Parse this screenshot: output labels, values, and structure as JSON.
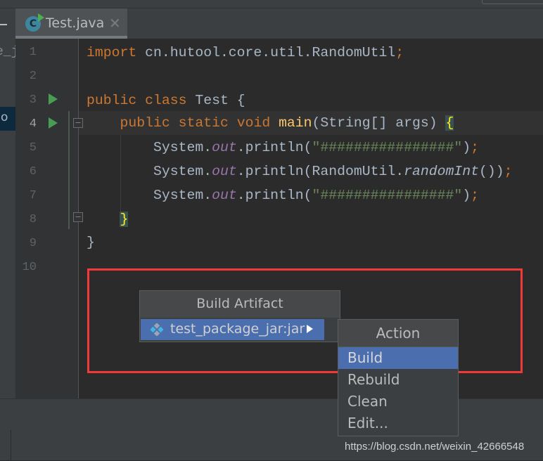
{
  "left_panel": {
    "partial_text": "e_ja",
    "selected_partial": "o"
  },
  "tab": {
    "label": "Test.java",
    "icon": "java-class-icon",
    "close_icon": "close-icon"
  },
  "editor": {
    "line_numbers": [
      "1",
      "2",
      "3",
      "4",
      "5",
      "6",
      "7",
      "8",
      "9",
      "10"
    ],
    "current_line": "4",
    "lines": {
      "l1": {
        "kw": "import",
        "rest": " cn.hutool.core.util.RandomUtil",
        "semi": ";"
      },
      "l3": {
        "kw1": "public",
        "kw2": "class",
        "rest": " Test {"
      },
      "l4": {
        "kw1": "public",
        "kw2": "static",
        "kw3": "void",
        "method": "main",
        "params": "(String[] args) ",
        "brace": "{"
      },
      "l5": {
        "obj": "System.",
        "field": "out",
        "call": ".println(",
        "str": "\"################\"",
        "end": ")",
        "semi": ";"
      },
      "l6": {
        "obj": "System.",
        "field": "out",
        "call": ".println(RandomUtil.",
        "method": "randomInt",
        "end": "())",
        "semi": ";"
      },
      "l7": {
        "obj": "System.",
        "field": "out",
        "call": ".println(",
        "str": "\"################\"",
        "end": ")",
        "semi": ";"
      },
      "l8": {
        "brace": "}"
      },
      "l9": {
        "brace": "}"
      }
    },
    "colors": {
      "keyword": "#cc7832",
      "string": "#6a8759",
      "field": "#9876aa",
      "method": "#ffc66d",
      "text": "#a9b7c6",
      "highlight": "#f03a3a"
    }
  },
  "build_artifact_popup": {
    "title": "Build Artifact",
    "item": "test_package_jar:jar",
    "item_icon": "artifact-icon"
  },
  "action_popup": {
    "title": "Action",
    "items": [
      "Build",
      "Rebuild",
      "Clean",
      "Edit..."
    ],
    "selected": "Build"
  },
  "watermark": "https://blog.csdn.net/weixin_42666548"
}
